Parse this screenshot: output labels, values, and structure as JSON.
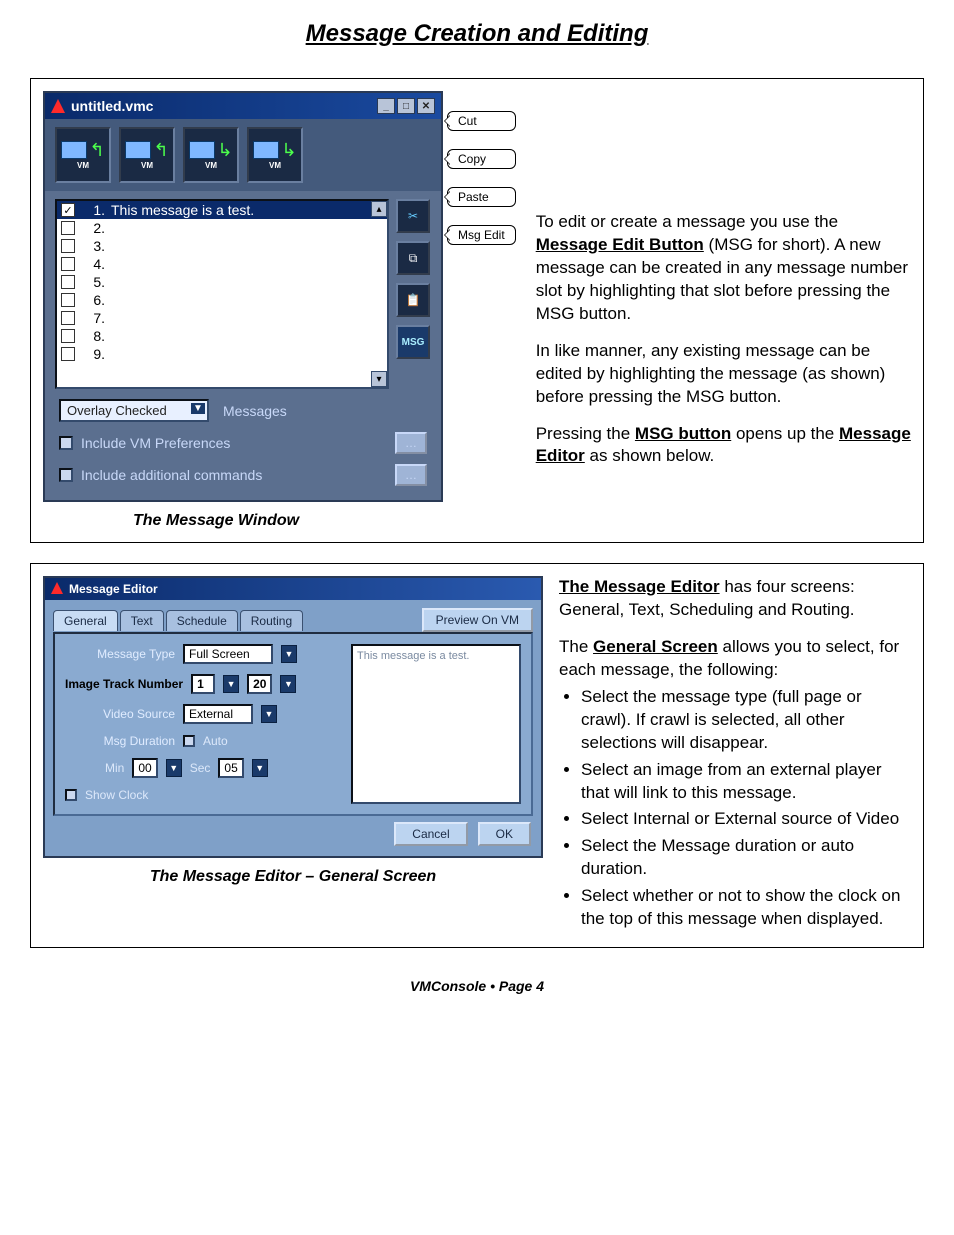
{
  "page_title": "Message Creation and Editing",
  "figure1": {
    "window_title": "untitled.vmc",
    "toolbar_items": [
      "VM",
      "VM",
      "VM",
      "VM"
    ],
    "messages": {
      "selected_index": 0,
      "rows": [
        {
          "num": "1.",
          "text": "This message is a test.",
          "checked": true
        },
        {
          "num": "2.",
          "text": "",
          "checked": false
        },
        {
          "num": "3.",
          "text": "",
          "checked": false
        },
        {
          "num": "4.",
          "text": "",
          "checked": false
        },
        {
          "num": "5.",
          "text": "",
          "checked": false
        },
        {
          "num": "6.",
          "text": "",
          "checked": false
        },
        {
          "num": "7.",
          "text": "",
          "checked": false
        },
        {
          "num": "8.",
          "text": "",
          "checked": false
        },
        {
          "num": "9.",
          "text": "",
          "checked": false
        }
      ]
    },
    "callouts": [
      "Cut",
      "Copy",
      "Paste",
      "Msg Edit"
    ],
    "overlay_select": "Overlay Checked",
    "overlay_label": "Messages",
    "include_vm": "Include VM Preferences",
    "include_cmds": "Include additional commands",
    "caption": "The Message Window"
  },
  "right_text_1": {
    "p1_a": "To edit or create a message you use the ",
    "p1_b": "Message Edit Button",
    "p1_c": " (MSG for short). A new message can be created in any message number slot by highlighting that slot before pressing the MSG button.",
    "p2": "In like manner, any existing message can be edited by highlighting the message (as shown) before pressing the MSG button.",
    "p3_a": "Pressing the ",
    "p3_b": "MSG button",
    "p3_c": " opens up the ",
    "p3_d": "Message Editor",
    "p3_e": " as shown below."
  },
  "figure2": {
    "window_title": "Message Editor",
    "tabs": [
      "General",
      "Text",
      "Schedule",
      "Routing"
    ],
    "preview_btn": "Preview On VM",
    "preview_text": "This message is a test.",
    "form": {
      "msg_type_label": "Message Type",
      "msg_type_value": "Full Screen",
      "track_label": "Image Track Number",
      "track_a": "1",
      "track_b": "20",
      "video_label": "Video Source",
      "video_value": "External",
      "duration_label": "Msg Duration",
      "auto_label": "Auto",
      "min_label": "Min",
      "min_value": "00",
      "sec_label": "Sec",
      "sec_value": "05",
      "show_clock": "Show Clock"
    },
    "cancel": "Cancel",
    "ok": "OK",
    "caption": "The Message Editor – General Screen"
  },
  "right_text_2": {
    "p1_a": "The Message Editor",
    "p1_b": " has four screens: General, Text, Scheduling and Routing.",
    "p2_a": "The ",
    "p2_b": "General Screen",
    "p2_c": " allows you to select, for each message, the following:",
    "bullets": [
      "Select the message type (full page or crawl). If crawl is selected, all other selections will disappear.",
      "Select an image from an external player that will link to this message.",
      "Select Internal or External source of Video",
      "Select the Message duration or auto duration.",
      "Select whether or not to show the clock on the top of this message when displayed."
    ]
  },
  "footer": "VMConsole • Page 4"
}
